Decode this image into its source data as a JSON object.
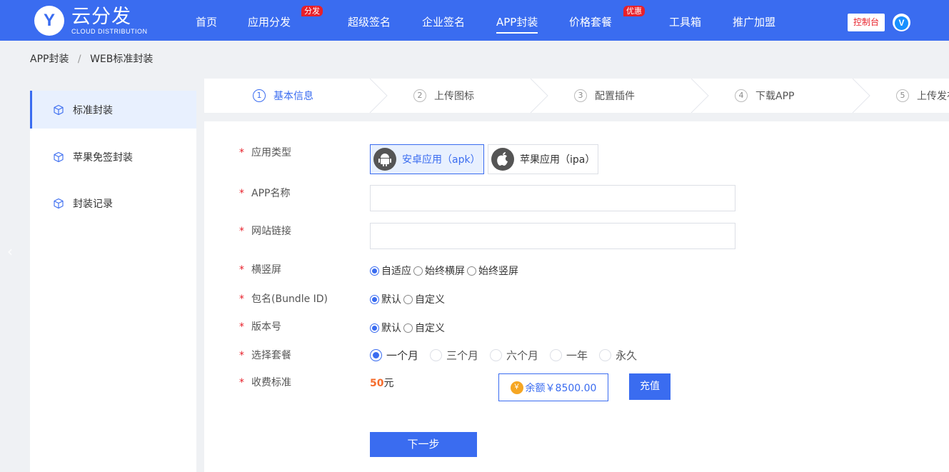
{
  "brand": {
    "logo_letter": "Y",
    "name": "云分发",
    "sub": "CLOUD DISTRIBUTION"
  },
  "nav": {
    "items": [
      {
        "label": "首页"
      },
      {
        "label": "应用分发",
        "badge": "分发"
      },
      {
        "label": "超级签名"
      },
      {
        "label": "企业签名"
      },
      {
        "label": "APP封装",
        "active": true
      },
      {
        "label": "价格套餐",
        "badge": "优惠"
      },
      {
        "label": "工具箱"
      },
      {
        "label": "推广加盟"
      }
    ],
    "console": "控制台",
    "avatar_letter": "V"
  },
  "breadcrumb": {
    "root": "APP封装",
    "separator": "/",
    "current": "WEB标准封装"
  },
  "sidebar": {
    "items": [
      {
        "label": "标准封装",
        "icon": "cube-icon",
        "active": true
      },
      {
        "label": "苹果免签封装",
        "icon": "cube-icon"
      },
      {
        "label": "封装记录",
        "icon": "cube-icon"
      }
    ]
  },
  "steps": [
    {
      "num": "1",
      "label": "基本信息",
      "active": true
    },
    {
      "num": "2",
      "label": "上传图标"
    },
    {
      "num": "3",
      "label": "配置插件"
    },
    {
      "num": "4",
      "label": "下载APP"
    },
    {
      "num": "5",
      "label": "上传发布"
    }
  ],
  "form": {
    "required_mark": "*",
    "app_type": {
      "label": "应用类型",
      "options": [
        {
          "label": "安卓应用（apk）",
          "icon": "android-icon",
          "selected": true
        },
        {
          "label": "苹果应用（ipa）",
          "icon": "apple-icon"
        }
      ]
    },
    "app_name": {
      "label": "APP名称",
      "value": "",
      "placeholder": ""
    },
    "site_url": {
      "label": "网站链接",
      "value": "",
      "placeholder": ""
    },
    "orientation": {
      "label": "横竖屏",
      "options": [
        {
          "label": "自适应",
          "checked": true
        },
        {
          "label": "始终横屏"
        },
        {
          "label": "始终竖屏"
        }
      ]
    },
    "bundle_id": {
      "label": "包名(Bundle ID)",
      "options": [
        {
          "label": "默认",
          "checked": true
        },
        {
          "label": "自定义"
        }
      ]
    },
    "version": {
      "label": "版本号",
      "options": [
        {
          "label": "默认",
          "checked": true
        },
        {
          "label": "自定义"
        }
      ]
    },
    "plan": {
      "label": "选择套餐",
      "options": [
        {
          "label": "一个月",
          "checked": true
        },
        {
          "label": "三个月"
        },
        {
          "label": "六个月"
        },
        {
          "label": "一年"
        },
        {
          "label": "永久"
        }
      ]
    },
    "fee": {
      "label": "收费标准",
      "amount": "50",
      "unit": "元",
      "balance_label": "余额",
      "balance_value": "￥8500.00",
      "coin_symbol": "￥",
      "recharge": "充值"
    },
    "next": "下一步"
  },
  "colors": {
    "primary": "#3a6cf0",
    "badge": "#e8202a",
    "price": "#f56c2c",
    "coin": "#f5a623"
  }
}
